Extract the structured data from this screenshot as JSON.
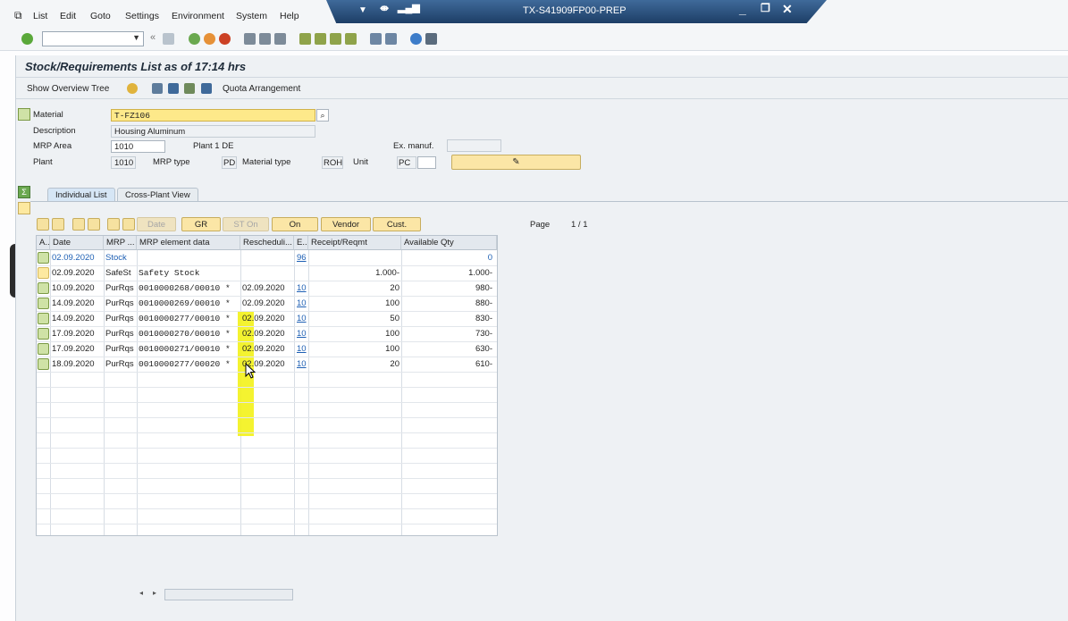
{
  "menu": [
    "List",
    "Edit",
    "Goto",
    "Settings",
    "Environment",
    "System",
    "Help"
  ],
  "window_title": "TX-S41909FP00-PREP",
  "toolbar": {
    "command_field_value": ""
  },
  "screen_title": "Stock/Requirements List as of 17:14 hrs",
  "app_toolbar": {
    "show_overview_tree": "Show Overview Tree",
    "quota_arrangement": "Quota Arrangement"
  },
  "header": {
    "material_label": "Material",
    "material_value": "T-FZ106",
    "description_label": "Description",
    "description_value": "Housing Aluminum",
    "mrp_area_label": "MRP Area",
    "mrp_area_value": "1010",
    "mrp_area_text": "Plant 1 DE",
    "ex_manuf_label": "Ex. manuf.",
    "ex_manuf_value": "",
    "plant_label": "Plant",
    "plant_value": "1010",
    "mrp_type_label": "MRP type",
    "mrp_type_value": "PD",
    "material_type_label": "Material type",
    "material_type_value": "ROH",
    "unit_label": "Unit",
    "unit_value": "PC",
    "unit_value2": ""
  },
  "tabs": {
    "individual": "Individual List",
    "cross_plant": "Cross-Plant View"
  },
  "grid_toolbar": {
    "date": "Date",
    "gr": "GR",
    "st_on": "ST On",
    "on": "On",
    "vendor": "Vendor",
    "cust": "Cust.",
    "page_label": "Page",
    "page_value": "1 / 1"
  },
  "grid": {
    "columns": [
      "A..",
      "Date",
      "MRP ...",
      "MRP element data",
      "Rescheduli...",
      "E..",
      "Receipt/Reqmt",
      "Available Qty"
    ],
    "rows": [
      {
        "date": "02.09.2020",
        "mrp": "Stock",
        "data": "",
        "resched": "",
        "e": "96",
        "receipt": "",
        "avail": "0"
      },
      {
        "date": "02.09.2020",
        "mrp": "SafeSt",
        "data": "Safety Stock",
        "resched": "",
        "e": "",
        "receipt": "1.000-",
        "avail": "1.000-"
      },
      {
        "date": "10.09.2020",
        "mrp": "PurRqs",
        "data": "0010000268/00010",
        "resched": "02.09.2020",
        "e": "10",
        "receipt": "20",
        "avail": "980-"
      },
      {
        "date": "14.09.2020",
        "mrp": "PurRqs",
        "data": "0010000269/00010",
        "resched": "02.09.2020",
        "e": "10",
        "receipt": "100",
        "avail": "880-"
      },
      {
        "date": "14.09.2020",
        "mrp": "PurRqs",
        "data": "0010000277/00010",
        "resched": "02.09.2020",
        "e": "10",
        "receipt": "50",
        "avail": "830-"
      },
      {
        "date": "17.09.2020",
        "mrp": "PurRqs",
        "data": "0010000270/00010",
        "resched": "02.09.2020",
        "e": "10",
        "receipt": "100",
        "avail": "730-"
      },
      {
        "date": "17.09.2020",
        "mrp": "PurRqs",
        "data": "0010000271/00010",
        "resched": "02.09.2020",
        "e": "10",
        "receipt": "100",
        "avail": "630-"
      },
      {
        "date": "18.09.2020",
        "mrp": "PurRqs",
        "data": "0010000277/00020",
        "resched": "02.09.2020",
        "e": "10",
        "receipt": "20",
        "avail": "610-"
      }
    ],
    "star": "*"
  }
}
